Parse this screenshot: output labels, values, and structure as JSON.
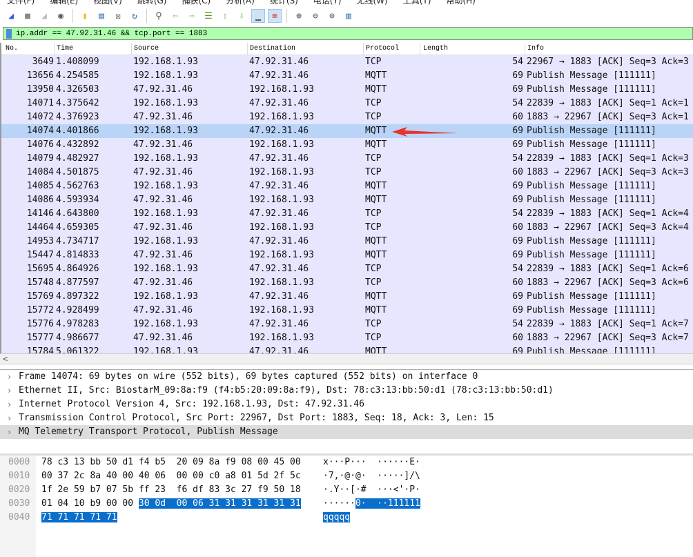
{
  "menu": [
    "文件(F)",
    "编辑(E)",
    "视图(V)",
    "跳转(G)",
    "捕获(C)",
    "分析(A)",
    "统计(S)",
    "电话(Y)",
    "无线(W)",
    "工具(T)",
    "帮助(H)"
  ],
  "filter": "ip.addr == 47.92.31.46 && tcp.port == 1883",
  "columns": [
    "No.",
    "Time",
    "Source",
    "Destination",
    "Protocol",
    "Length",
    "Info"
  ],
  "packets": [
    [
      "3649",
      "1.408099",
      "192.168.1.93",
      "47.92.31.46",
      "TCP",
      "54",
      "22967 → 1883 [ACK] Seq=3 Ack=3"
    ],
    [
      "13656",
      "4.254585",
      "192.168.1.93",
      "47.92.31.46",
      "MQTT",
      "69",
      "Publish Message [111111]"
    ],
    [
      "13950",
      "4.326503",
      "47.92.31.46",
      "192.168.1.93",
      "MQTT",
      "69",
      "Publish Message [111111]"
    ],
    [
      "14071",
      "4.375642",
      "192.168.1.93",
      "47.92.31.46",
      "TCP",
      "54",
      "22839 → 1883 [ACK] Seq=1 Ack=1"
    ],
    [
      "14072",
      "4.376923",
      "47.92.31.46",
      "192.168.1.93",
      "TCP",
      "60",
      "1883 → 22967 [ACK] Seq=3 Ack=1"
    ],
    [
      "14074",
      "4.401866",
      "192.168.1.93",
      "47.92.31.46",
      "MQTT",
      "69",
      "Publish Message [111111]"
    ],
    [
      "14076",
      "4.432892",
      "47.92.31.46",
      "192.168.1.93",
      "MQTT",
      "69",
      "Publish Message [111111]"
    ],
    [
      "14079",
      "4.482927",
      "192.168.1.93",
      "47.92.31.46",
      "TCP",
      "54",
      "22839 → 1883 [ACK] Seq=1 Ack=3"
    ],
    [
      "14084",
      "4.501875",
      "47.92.31.46",
      "192.168.1.93",
      "TCP",
      "60",
      "1883 → 22967 [ACK] Seq=3 Ack=3"
    ],
    [
      "14085",
      "4.562763",
      "192.168.1.93",
      "47.92.31.46",
      "MQTT",
      "69",
      "Publish Message [111111]"
    ],
    [
      "14086",
      "4.593934",
      "47.92.31.46",
      "192.168.1.93",
      "MQTT",
      "69",
      "Publish Message [111111]"
    ],
    [
      "14146",
      "4.643800",
      "192.168.1.93",
      "47.92.31.46",
      "TCP",
      "54",
      "22839 → 1883 [ACK] Seq=1 Ack=4"
    ],
    [
      "14464",
      "4.659305",
      "47.92.31.46",
      "192.168.1.93",
      "TCP",
      "60",
      "1883 → 22967 [ACK] Seq=3 Ack=4"
    ],
    [
      "14953",
      "4.734717",
      "192.168.1.93",
      "47.92.31.46",
      "MQTT",
      "69",
      "Publish Message [111111]"
    ],
    [
      "15447",
      "4.814833",
      "47.92.31.46",
      "192.168.1.93",
      "MQTT",
      "69",
      "Publish Message [111111]"
    ],
    [
      "15695",
      "4.864926",
      "192.168.1.93",
      "47.92.31.46",
      "TCP",
      "54",
      "22839 → 1883 [ACK] Seq=1 Ack=6"
    ],
    [
      "15748",
      "4.877597",
      "47.92.31.46",
      "192.168.1.93",
      "TCP",
      "60",
      "1883 → 22967 [ACK] Seq=3 Ack=6"
    ],
    [
      "15769",
      "4.897322",
      "192.168.1.93",
      "47.92.31.46",
      "MQTT",
      "69",
      "Publish Message [111111]"
    ],
    [
      "15772",
      "4.928499",
      "47.92.31.46",
      "192.168.1.93",
      "MQTT",
      "69",
      "Publish Message [111111]"
    ],
    [
      "15776",
      "4.978283",
      "192.168.1.93",
      "47.92.31.46",
      "TCP",
      "54",
      "22839 → 1883 [ACK] Seq=1 Ack=7"
    ],
    [
      "15777",
      "4.986677",
      "47.92.31.46",
      "192.168.1.93",
      "TCP",
      "60",
      "1883 → 22967 [ACK] Seq=3 Ack=7"
    ],
    [
      "15784",
      "5.061322",
      "192.168.1.93",
      "47.92.31.46",
      "MQTT",
      "69",
      "Publish Message [111111]"
    ]
  ],
  "selected_index": 5,
  "details": [
    "Frame 14074: 69 bytes on wire (552 bits), 69 bytes captured (552 bits) on interface 0",
    "Ethernet II, Src: BiostarM_09:8a:f9 (f4:b5:20:09:8a:f9), Dst: 78:c3:13:bb:50:d1 (78:c3:13:bb:50:d1)",
    "Internet Protocol Version 4, Src: 192.168.1.93, Dst: 47.92.31.46",
    "Transmission Control Protocol, Src Port: 22967, Dst Port: 1883, Seq: 18, Ack: 3, Len: 15",
    "MQ Telemetry Transport Protocol, Publish Message"
  ],
  "hex": [
    {
      "off": "0000",
      "bytes": "78 c3 13 bb 50 d1 f4 b5  20 09 8a f9 08 00 45 00",
      "bytes_hi": "",
      "ascii": "x···P···  ······E·",
      "ascii_hi": ""
    },
    {
      "off": "0010",
      "bytes": "00 37 2c 8a 40 00 40 06  00 00 c0 a8 01 5d 2f 5c",
      "bytes_hi": "",
      "ascii": "·7,·@·@·  ·····]/\\",
      "ascii_hi": ""
    },
    {
      "off": "0020",
      "bytes": "1f 2e 59 b7 07 5b ff 23  f6 df 83 3c 27 f9 50 18",
      "bytes_hi": "",
      "ascii": "·.Y··[·#  ···<'·P·",
      "ascii_hi": ""
    },
    {
      "off": "0030",
      "bytes": "01 04 10 b9 00 00 ",
      "bytes_hi": "30 0d  00 06 31 31 31 31 31 31",
      "ascii": "······",
      "ascii_hi": "0·  ··111111"
    },
    {
      "off": "0040",
      "bytes": "",
      "bytes_hi": "71 71 71 71 71",
      "ascii": "",
      "ascii_hi": "qqqqq"
    }
  ],
  "colors": {
    "row_bg": "#e7e6ff",
    "selected_bg": "#b9d4f6",
    "filter_bg": "#afffaf",
    "hex_highlight": "#0a6ecb",
    "arrow": "#e8322c"
  }
}
